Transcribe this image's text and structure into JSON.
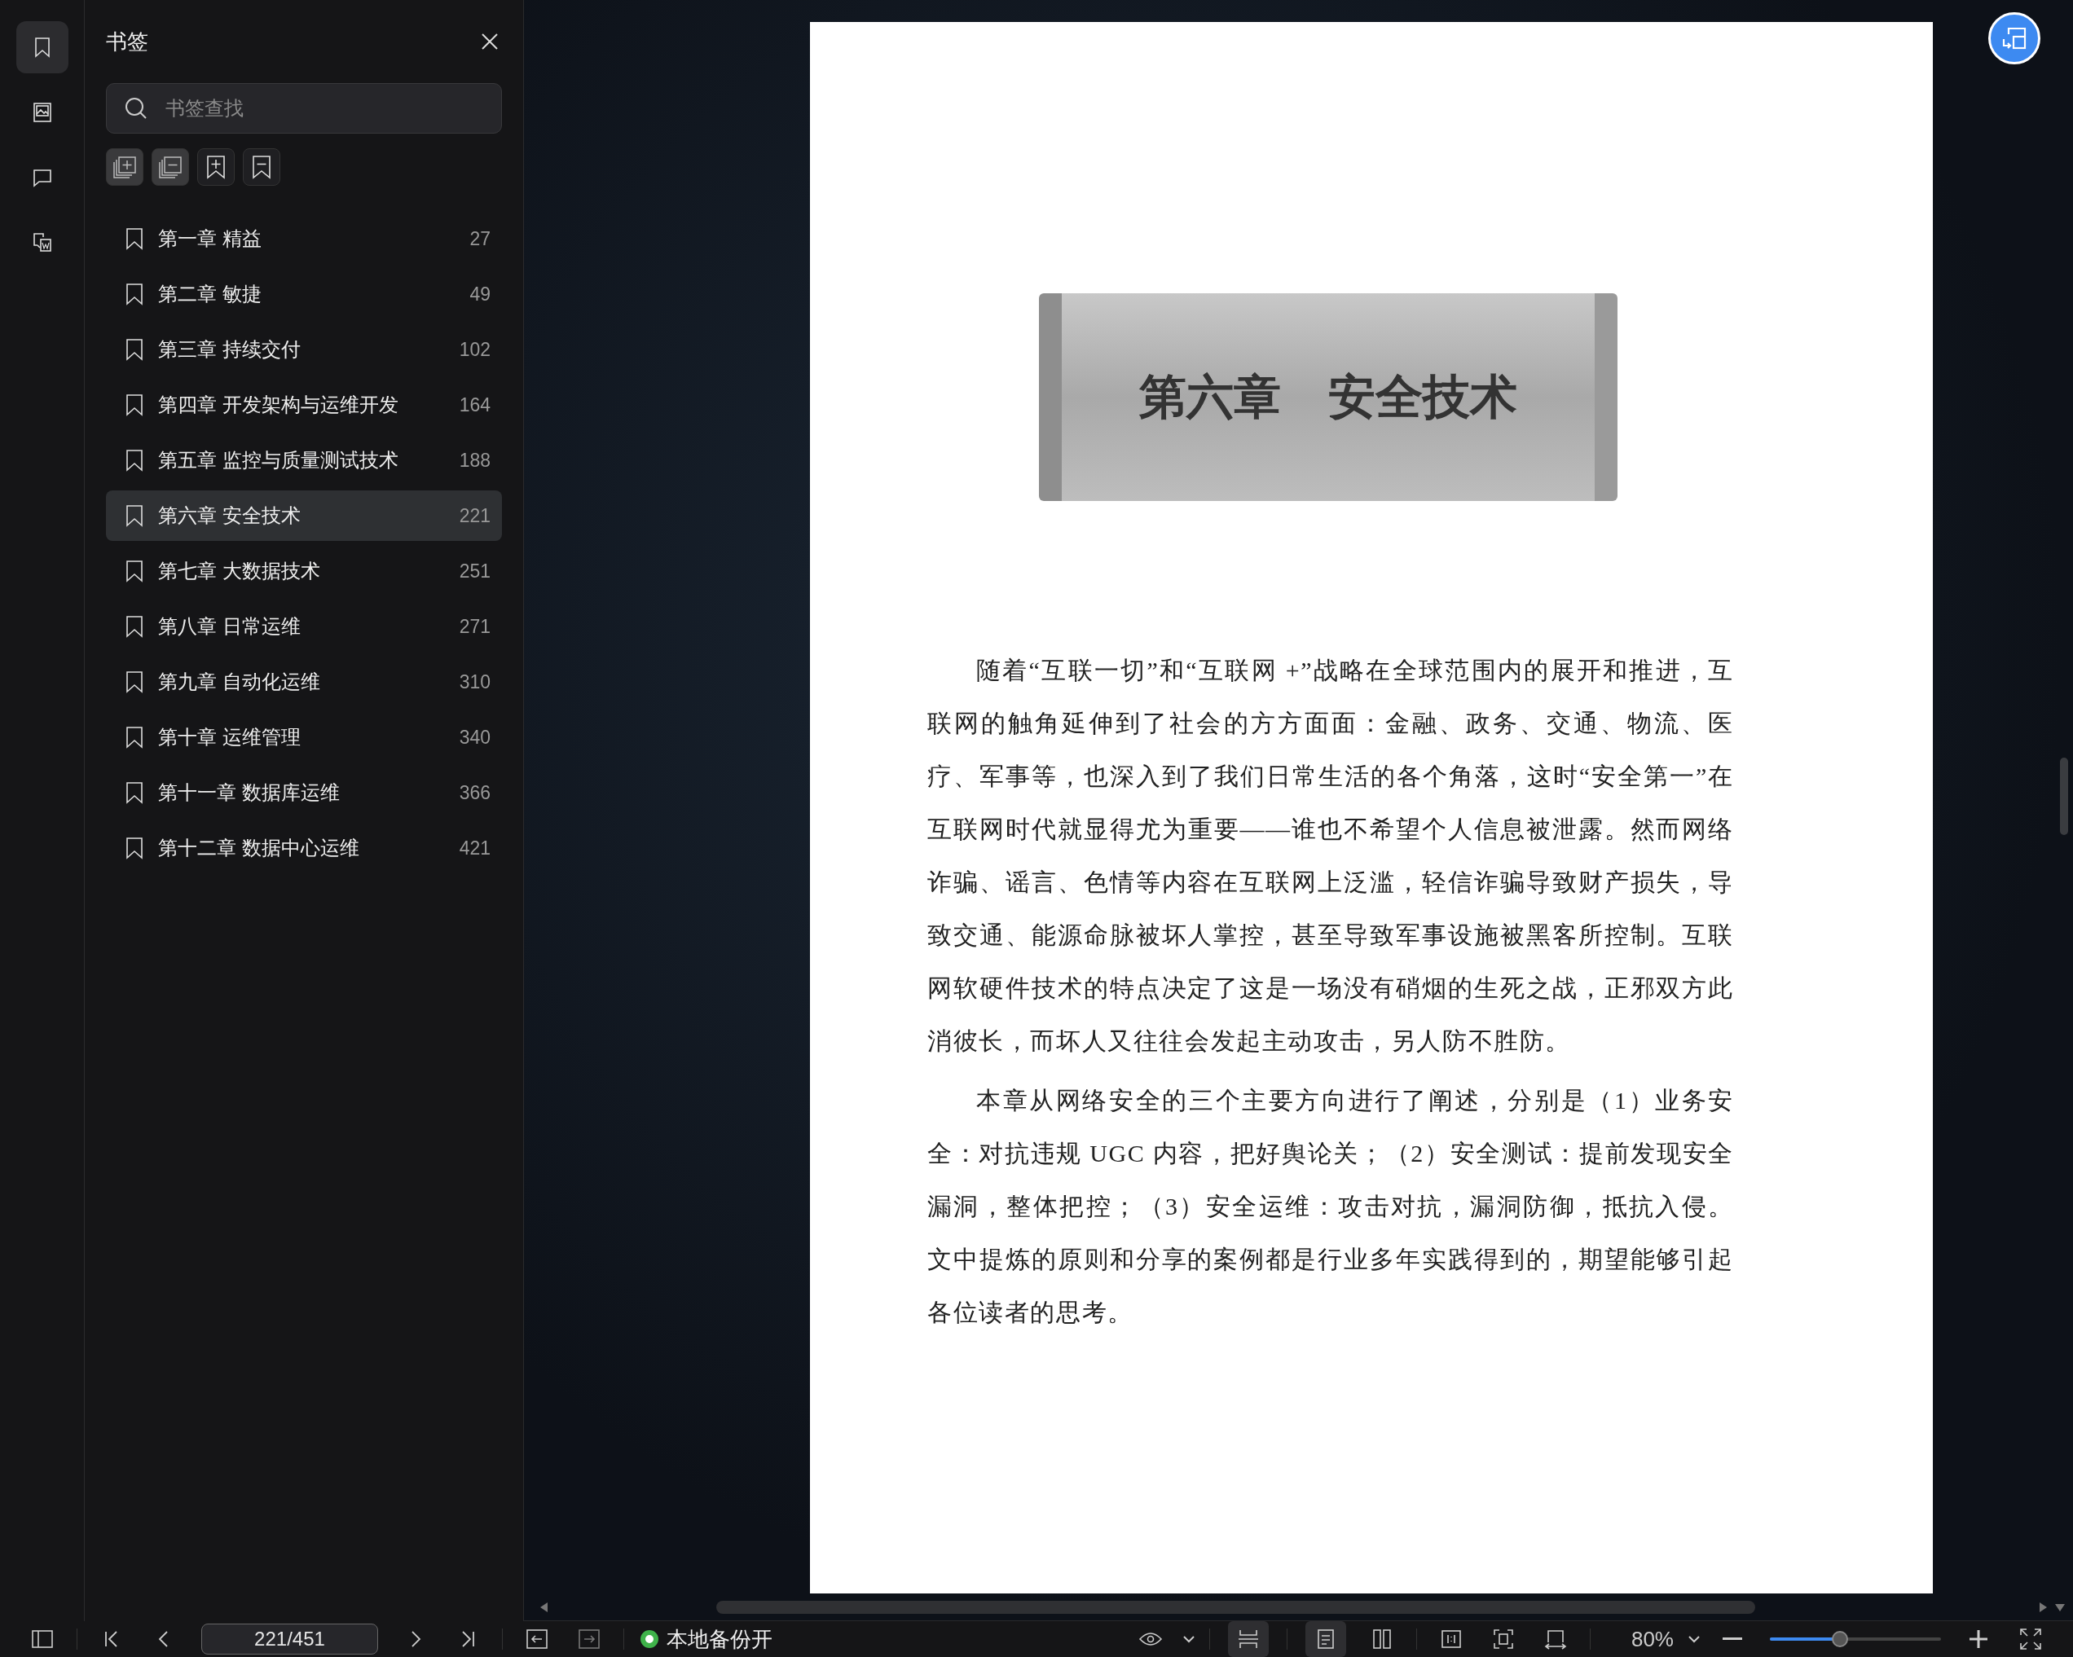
{
  "rail": [
    {
      "kind": "bookmarks",
      "selected": true
    },
    {
      "kind": "thumbnails",
      "selected": false
    },
    {
      "kind": "comments",
      "selected": false
    },
    {
      "kind": "convert",
      "selected": false
    }
  ],
  "sidebar": {
    "title": "书签",
    "search": {
      "placeholder": "书签查找"
    },
    "bookmarks": [
      {
        "label": "第一章 精益",
        "page": "27",
        "selected": false
      },
      {
        "label": "第二章 敏捷",
        "page": "49",
        "selected": false
      },
      {
        "label": "第三章 持续交付",
        "page": "102",
        "selected": false
      },
      {
        "label": "第四章 开发架构与运维开发",
        "page": "164",
        "selected": false
      },
      {
        "label": "第五章 监控与质量测试技术",
        "page": "188",
        "selected": false
      },
      {
        "label": "第六章 安全技术",
        "page": "221",
        "selected": true
      },
      {
        "label": "第七章 大数据技术",
        "page": "251",
        "selected": false
      },
      {
        "label": "第八章 日常运维",
        "page": "271",
        "selected": false
      },
      {
        "label": "第九章 自动化运维",
        "page": "310",
        "selected": false
      },
      {
        "label": "第十章 运维管理",
        "page": "340",
        "selected": false
      },
      {
        "label": "第十一章 数据库运维",
        "page": "366",
        "selected": false
      },
      {
        "label": "第十二章 数据中心运维",
        "page": "421",
        "selected": false
      }
    ]
  },
  "document": {
    "chapter_title": "第六章　安全技术",
    "paragraphs": [
      "随着“互联一切”和“互联网 +”战略在全球范围内的展开和推进，互联网的触角延伸到了社会的方方面面：金融、政务、交通、物流、医疗、军事等，也深入到了我们日常生活的各个角落，这时“安全第一”在互联网时代就显得尤为重要——谁也不希望个人信息被泄露。然而网络诈骗、谣言、色情等内容在互联网上泛滥，轻信诈骗导致财产损失，导致交通、能源命脉被坏人掌控，甚至导致军事设施被黑客所控制。互联网软硬件技术的特点决定了这是一场没有硝烟的生死之战，正邪双方此消彼长，而坏人又往往会发起主动攻击，另人防不胜防。",
      "本章从网络安全的三个主要方向进行了阐述，分别是（1）业务安全：对抗违规 UGC 内容，把好舆论关；（2）安全测试：提前发现安全漏洞，整体把控；（3）安全运维：攻击对抗，漏洞防御，抵抗入侵。文中提炼的原则和分享的案例都是行业多年实践得到的，期望能够引起各位读者的思考。"
    ]
  },
  "status_bar": {
    "page_field": "221/451",
    "backup": {
      "label": "本地备份开",
      "on": true
    },
    "view_modes": [
      {
        "kind": "continuous",
        "selected": true
      },
      {
        "kind": "single",
        "selected": true
      },
      {
        "kind": "double",
        "selected": false
      }
    ],
    "zoom": "80%",
    "zoom_slider": {
      "level": 0.41
    }
  }
}
